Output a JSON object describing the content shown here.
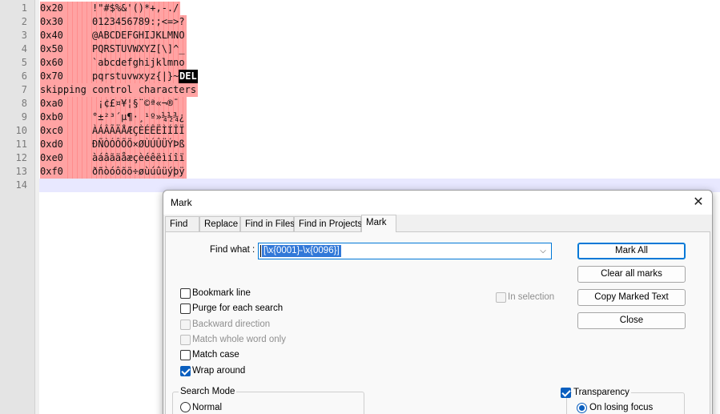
{
  "editor": {
    "lines": [
      {
        "num": "1",
        "prefix": "0x20",
        "chars": "!\"#$%&'()*+,-./"
      },
      {
        "num": "2",
        "prefix": "0x30",
        "chars": "0123456789:;<=>?"
      },
      {
        "num": "3",
        "prefix": "0x40",
        "chars": "@ABCDEFGHIJKLMNO"
      },
      {
        "num": "4",
        "prefix": "0x50",
        "chars": "PQRSTUVWXYZ[\\]^_"
      },
      {
        "num": "5",
        "prefix": "0x60",
        "chars": "`abcdefghijklmno"
      },
      {
        "num": "6",
        "prefix": "0x70",
        "chars": "pqrstuvwxyz{|}~",
        "tail": "DEL"
      },
      {
        "num": "7",
        "text": "skipping control characters"
      },
      {
        "num": "8",
        "prefix": "0xa0",
        "chars": " ¡¢£¤¥¦§¨©ª«¬­®¯"
      },
      {
        "num": "9",
        "prefix": "0xb0",
        "chars": "°±²³´µ¶·¸¹º»¼½¾¿"
      },
      {
        "num": "10",
        "prefix": "0xc0",
        "chars": "ÀÁÂÃÄÅÆÇÈÉÊËÌÍÎÏ"
      },
      {
        "num": "11",
        "prefix": "0xd0",
        "chars": "ÐÑÒÓÔÕÖ×ØÙÚÛÜÝÞß"
      },
      {
        "num": "12",
        "prefix": "0xe0",
        "chars": "àáâãäåæçèéêëìíîï"
      },
      {
        "num": "13",
        "prefix": "0xf0",
        "chars": "ðñòóôõö÷øùúûüýþÿ"
      },
      {
        "num": "14",
        "text": ""
      }
    ],
    "mark_color": "#ffa3a3"
  },
  "dialog": {
    "title": "Mark",
    "close_glyph": "✕",
    "tabs": [
      "Find",
      "Replace",
      "Find in Files",
      "Find in Projects",
      "Mark"
    ],
    "active_tab": "Mark",
    "find_what_label": "Find what :",
    "find_what_value": "[\\x{0001}-\\x{0096}]",
    "buttons": {
      "mark_all": "Mark All",
      "clear_all_marks": "Clear all marks",
      "copy_marked_text": "Copy Marked Text",
      "close": "Close"
    },
    "options": {
      "bookmark_line": {
        "label": "Bookmark line",
        "checked": false,
        "enabled": true
      },
      "purge_each_search": {
        "label": "Purge for each search",
        "checked": false,
        "enabled": true
      },
      "backward_direction": {
        "label": "Backward direction",
        "checked": false,
        "enabled": false
      },
      "match_whole_word": {
        "label": "Match whole word only",
        "checked": false,
        "enabled": false
      },
      "match_case": {
        "label": "Match case",
        "checked": false,
        "enabled": true
      },
      "wrap_around": {
        "label": "Wrap around",
        "checked": true,
        "enabled": true
      },
      "in_selection": {
        "label": "In selection",
        "checked": false,
        "enabled": false
      }
    },
    "search_mode": {
      "label": "Search Mode",
      "normal": "Normal"
    },
    "transparency": {
      "label": "Transparency",
      "checked": true,
      "on_losing_focus": "On losing focus"
    },
    "accent_color": "#0078d7"
  }
}
